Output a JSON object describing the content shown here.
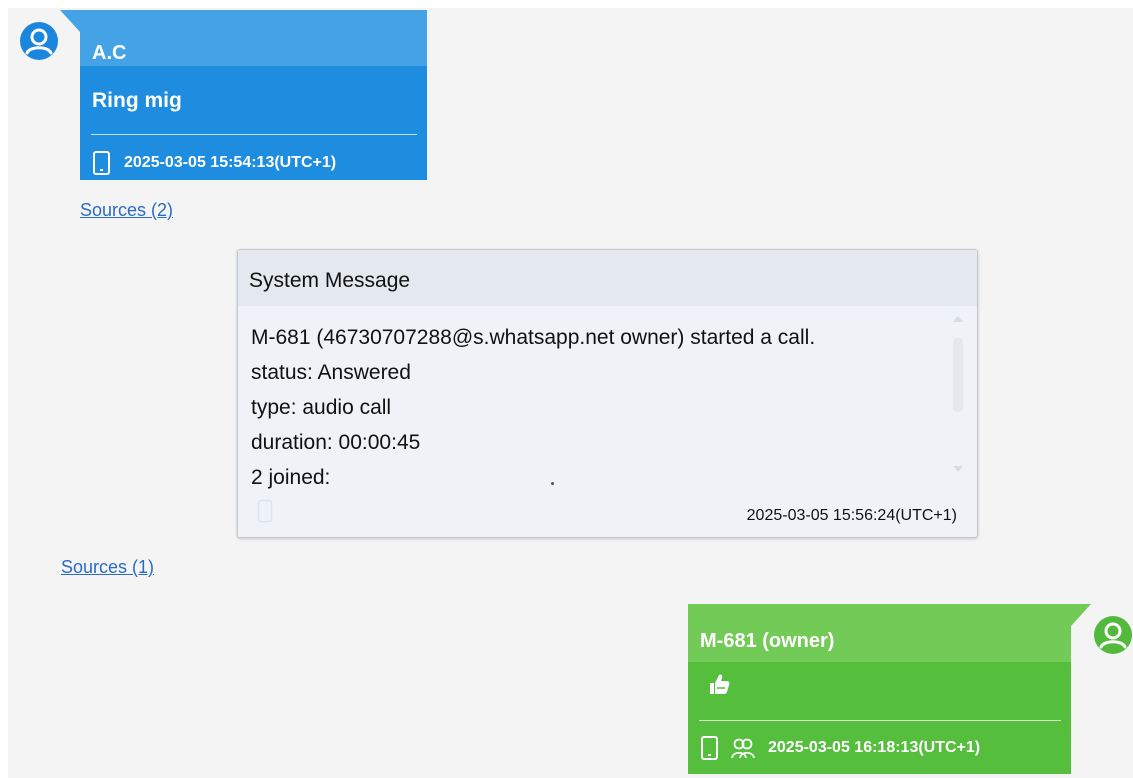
{
  "messages": [
    {
      "sender": "A.C",
      "text": "Ring mig",
      "timestamp": "2025-03-05 15:54:13(UTC+1)",
      "avatar_icon": "user-circle-icon",
      "device_icon": "phone-icon",
      "color": "#1e8de0"
    },
    {
      "sender": "M-681 (owner)",
      "reaction_icon": "thumbs-up-icon",
      "timestamp": "2025-03-05 16:18:13(UTC+1)",
      "avatar_icon": "user-circle-icon",
      "device_icon": "phone-icon",
      "group_icon": "group-users-icon",
      "color": "#55be3d"
    }
  ],
  "sources_links": [
    "Sources (2)",
    "Sources (1)"
  ],
  "system_message": {
    "title": "System Message",
    "lines": [
      "M-681 (46730707288@s.whatsapp.net owner) started a call.",
      "status: Answered",
      "type: audio call",
      "duration: 00:00:45",
      "2 joined:"
    ],
    "timestamp": "2025-03-05 15:56:24(UTC+1)",
    "device_icon": "phone-icon"
  },
  "colors": {
    "blue_bubble": "#1e8de0",
    "green_bubble": "#55be3d",
    "link": "#2a6cc4",
    "system_bg": "#eff3f7"
  }
}
